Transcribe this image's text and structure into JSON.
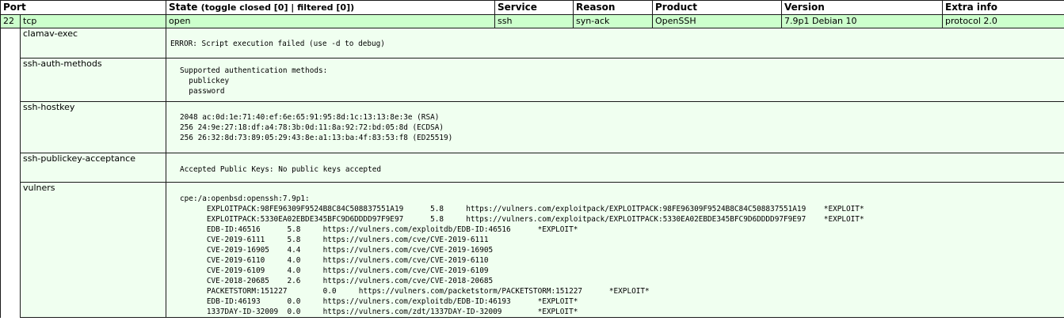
{
  "headers": {
    "port": "Port",
    "state": "State",
    "state_toggle": "(toggle closed [0] | filtered [0])",
    "service": "Service",
    "reason": "Reason",
    "product": "Product",
    "version": "Version",
    "extra_info": "Extra info"
  },
  "port_row": {
    "port": "22",
    "protocol": "tcp",
    "state": "open",
    "service": "ssh",
    "reason": "syn-ack",
    "product": "OpenSSH",
    "version": "7.9p1 Debian 10",
    "extra_info": "protocol 2.0"
  },
  "scripts": [
    {
      "name": "clamav-exec",
      "output": "ERROR: Script execution failed (use -d to debug)"
    },
    {
      "name": "ssh-auth-methods",
      "output": "Supported authentication methods: \n  publickey\n  password"
    },
    {
      "name": "ssh-hostkey",
      "output": "2048 ac:0d:1e:71:40:ef:6e:65:91:95:8d:1c:13:13:8e:3e (RSA)\n256 24:9e:27:18:df:a4:78:3b:0d:11:8a:92:72:bd:05:8d (ECDSA)\n256 26:32:8d:73:89:05:29:43:8e:a1:13:ba:4f:83:53:f8 (ED25519)"
    },
    {
      "name": "ssh-publickey-acceptance",
      "output": "Accepted Public Keys: No public keys accepted"
    },
    {
      "name": "vulners",
      "output": "cpe:/a:openbsd:openssh:7.9p1: \n      EXPLOITPACK:98FE96309F9524B8C84C508837551A19\t5.8\thttps://vulners.com/exploitpack/EXPLOITPACK:98FE96309F9524B8C84C508837551A19\t*EXPLOIT*\n      EXPLOITPACK:5330EA02EBDE345BFC9D6DDDD97F9E97\t5.8\thttps://vulners.com/exploitpack/EXPLOITPACK:5330EA02EBDE345BFC9D6DDDD97F9E97\t*EXPLOIT*\n      EDB-ID:46516\t5.8\thttps://vulners.com/exploitdb/EDB-ID:46516\t*EXPLOIT*\n      CVE-2019-6111\t5.8\thttps://vulners.com/cve/CVE-2019-6111\n      CVE-2019-16905\t4.4\thttps://vulners.com/cve/CVE-2019-16905\n      CVE-2019-6110\t4.0\thttps://vulners.com/cve/CVE-2019-6110\n      CVE-2019-6109\t4.0\thttps://vulners.com/cve/CVE-2019-6109\n      CVE-2018-20685\t2.6\thttps://vulners.com/cve/CVE-2018-20685\n      PACKETSTORM:151227\t0.0\thttps://vulners.com/packetstorm/PACKETSTORM:151227\t*EXPLOIT*\n      EDB-ID:46193\t0.0\thttps://vulners.com/exploitdb/EDB-ID:46193\t*EXPLOIT*\n      1337DAY-ID-32009\t0.0\thttps://vulners.com/zdt/1337DAY-ID-32009\t*EXPLOIT*"
    }
  ],
  "colors": {
    "port_row_bg": "#ccffcc",
    "script_row_bg": "#f0fff0",
    "border": "#1a1a1a"
  }
}
